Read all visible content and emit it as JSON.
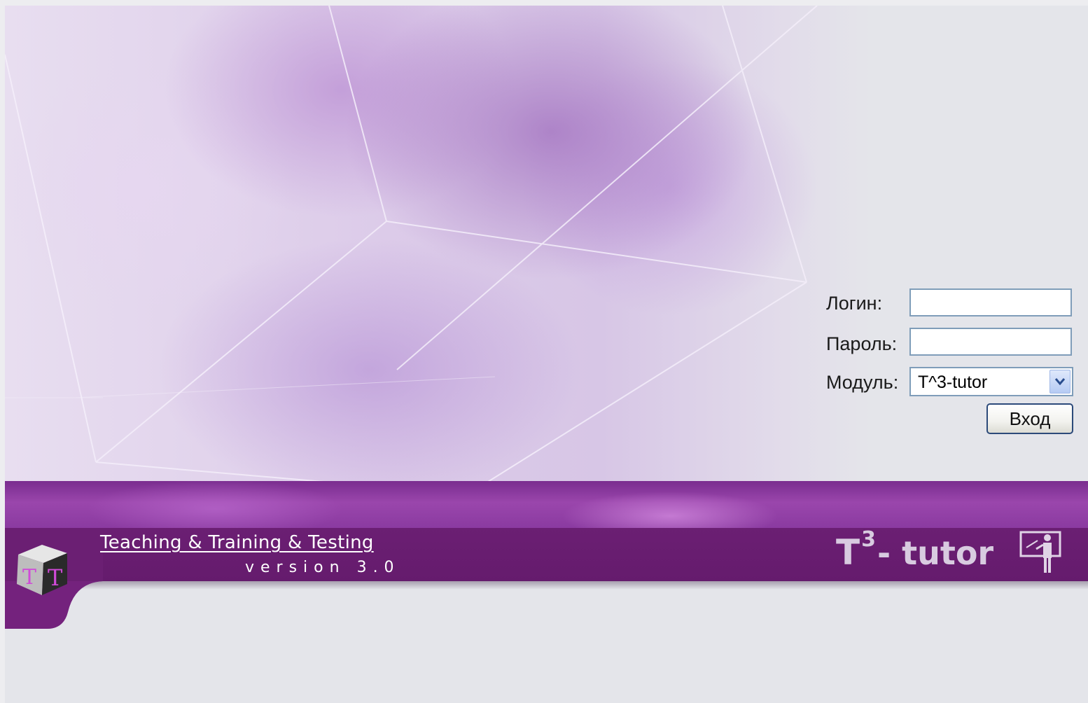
{
  "login": {
    "login_label": "Логин:",
    "login_value": "",
    "password_label": "Пароль:",
    "password_value": "",
    "module_label": "Модуль:",
    "module_selected": "T^3-tutor",
    "submit_label": "Вход"
  },
  "footer": {
    "tagline": "Teaching & Training & Testing",
    "version": "version 3.0",
    "brand_main": "T",
    "brand_sup": "3",
    "brand_rest": "- tutor",
    "logo_letters": [
      "T",
      "T"
    ]
  },
  "icons": {
    "logo": "tt-cube-logo",
    "teacher": "teacher-at-board-icon",
    "dropdown": "chevron-down-icon"
  },
  "colors": {
    "band_dark": "#651b6d",
    "band_light": "#9a46ac",
    "background": "#e4e5ea",
    "input_border": "#7f9db9"
  }
}
